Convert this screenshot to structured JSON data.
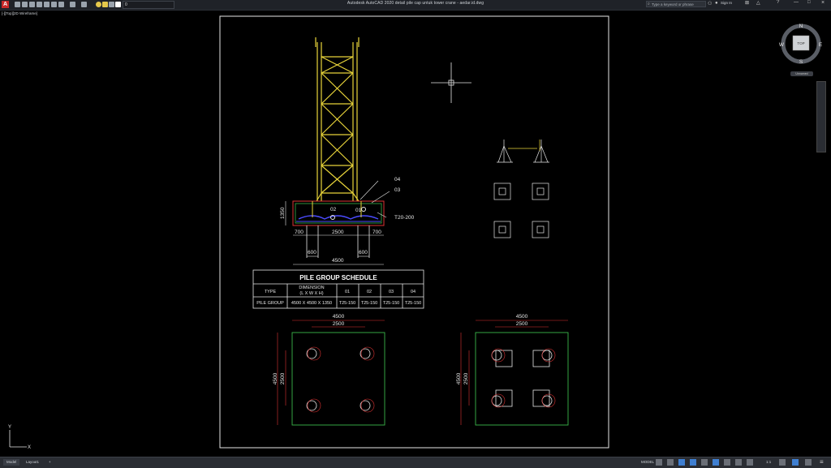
{
  "window": {
    "title": "Autodesk AutoCAD 2020   detail pile cap untuk tower crane - aedar.id.dwg",
    "search_placeholder": "Type a keyword or phrase",
    "sign_in": "Sign In",
    "layer_value": "0"
  },
  "viewport": {
    "label": "[-][Top][2D Wireframe]"
  },
  "viewcube": {
    "top": "TOP",
    "north": "N",
    "south": "S",
    "east": "E",
    "west": "W",
    "wcs": "Unnamed"
  },
  "drawing": {
    "labels": {
      "l04": "04",
      "l03": "03",
      "l01": "01",
      "l02": "02",
      "rebar": "T20-200",
      "h1350": "1350",
      "d700a": "700",
      "d2500": "2500",
      "d700b": "700",
      "d600a": "600",
      "d600b": "600",
      "d4500": "4500"
    },
    "plan_left": {
      "d4500": "4500",
      "d2500": "2500",
      "v4500": "4500",
      "v2500": "2500"
    },
    "plan_right": {
      "d4500": "4500",
      "d2500": "2500",
      "v4500": "4500",
      "v2500": "2500"
    }
  },
  "schedule": {
    "title": "PILE GROUP SCHEDULE",
    "headers": [
      "TYPE",
      "DIMENSION",
      "01",
      "02",
      "03",
      "04"
    ],
    "dim_sub": "(L X W X H)",
    "row": [
      "PILE GROUP",
      "4500 X 4500 X 1350",
      "T25-150",
      "T25-150",
      "T25-150",
      "T25-150"
    ]
  },
  "statusbar": {
    "tabs": [
      "Model",
      "Layout1",
      "+"
    ],
    "model_label": "MODEL",
    "scale": "1:1"
  }
}
